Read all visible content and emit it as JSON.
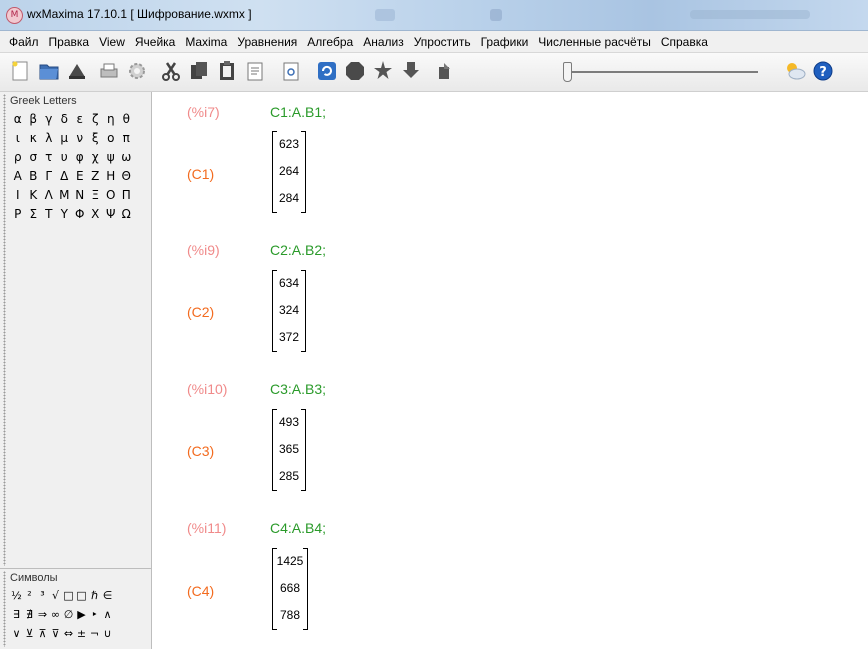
{
  "window": {
    "title": "wxMaxima 17.10.1 [ Шифрование.wxmx ]",
    "app_icon": "M"
  },
  "menu": [
    "Файл",
    "Правка",
    "View",
    "Ячейка",
    "Maxima",
    "Уравнения",
    "Алгебра",
    "Анализ",
    "Упростить",
    "Графики",
    "Численные расчёты",
    "Справка"
  ],
  "toolbar": {
    "icons": [
      "new-document-icon",
      "open-folder-icon",
      "save-icon",
      "print-icon",
      "config-gear-icon",
      "cut-icon",
      "copy-icon",
      "paste-icon",
      "select-all-icon",
      "find-icon",
      "restart-icon",
      "interrupt-icon",
      "evaluate-icon",
      "collapse-icon",
      "step-icon",
      "animation-slider",
      "weather-icon",
      "help-icon"
    ]
  },
  "greek_panel": {
    "title": "Greek Letters",
    "rows": [
      [
        "α",
        "β",
        "γ",
        "δ",
        "ε",
        "ζ",
        "η",
        "θ"
      ],
      [
        "ι",
        "κ",
        "λ",
        "μ",
        "ν",
        "ξ",
        "ο",
        "π"
      ],
      [
        "ρ",
        "σ",
        "τ",
        "υ",
        "φ",
        "χ",
        "ψ",
        "ω"
      ],
      [
        "Α",
        "Β",
        "Γ",
        "Δ",
        "Ε",
        "Ζ",
        "Η",
        "Θ"
      ],
      [
        "Ι",
        "Κ",
        "Λ",
        "Μ",
        "Ν",
        "Ξ",
        "Ο",
        "Π"
      ],
      [
        "Ρ",
        "Σ",
        "Τ",
        "Υ",
        "Φ",
        "Χ",
        "Ψ",
        "Ω"
      ]
    ]
  },
  "symbols_panel": {
    "title": "Символы",
    "rows": [
      [
        "½",
        "²",
        "³",
        "√",
        "□",
        "□",
        "ℏ",
        "∈"
      ],
      [
        "∃",
        "∄",
        "⇒",
        "∞",
        "∅",
        "▶",
        "‣",
        "∧"
      ],
      [
        "∨",
        "⊻",
        "⊼",
        "⊽",
        "⇔",
        "±",
        "¬",
        "∪"
      ]
    ]
  },
  "cells": [
    {
      "input_label": "(%i7)",
      "input": "C1:A.B1;",
      "output_label": "(C1)",
      "values": [
        "623",
        "264",
        "284"
      ]
    },
    {
      "input_label": "(%i9)",
      "input": "C2:A.B2;",
      "output_label": "(C2)",
      "values": [
        "634",
        "324",
        "372"
      ]
    },
    {
      "input_label": "(%i10)",
      "input": "C3:A.B3;",
      "output_label": "(C3)",
      "values": [
        "493",
        "365",
        "285"
      ]
    },
    {
      "input_label": "(%i11)",
      "input": "C4:A.B4;",
      "output_label": "(C4)",
      "values": [
        "1425",
        "668",
        "788"
      ]
    }
  ],
  "colors": {
    "input_label": "#f08a8a",
    "output_label": "#f36b1f",
    "input_code": "#2a9a2a"
  }
}
